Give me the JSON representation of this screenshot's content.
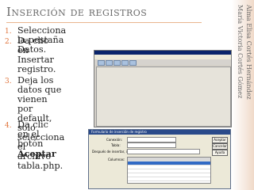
{
  "title": "Inserción de registros",
  "steps": [
    {
      "num": "1.",
      "text": "Selecciona la pestaña Datos."
    },
    {
      "num": "2.",
      "text": "Da clic en Insertar registro."
    },
    {
      "num": "3.",
      "lines": [
        "Deja los datos que",
        "vienen por default,",
        "solo selecciona el",
        "archivo tabla.php."
      ]
    },
    {
      "num": "4.",
      "lines": [
        "Da clic en el botón"
      ],
      "bold": "Aceptar"
    }
  ],
  "sidebar": {
    "line1": "María Victoria Cortés Gómez",
    "line2": "Alma Elisa Cortés Hernández"
  },
  "screenshot": {
    "dialog_title": "Formulario de inserción de registro",
    "labels": [
      "Conexión:",
      "Tabla:",
      "Después de insertar, ir a:",
      "Columnas:"
    ],
    "buttons": [
      "Aceptar",
      "Cancelar",
      "Ayuda"
    ]
  }
}
